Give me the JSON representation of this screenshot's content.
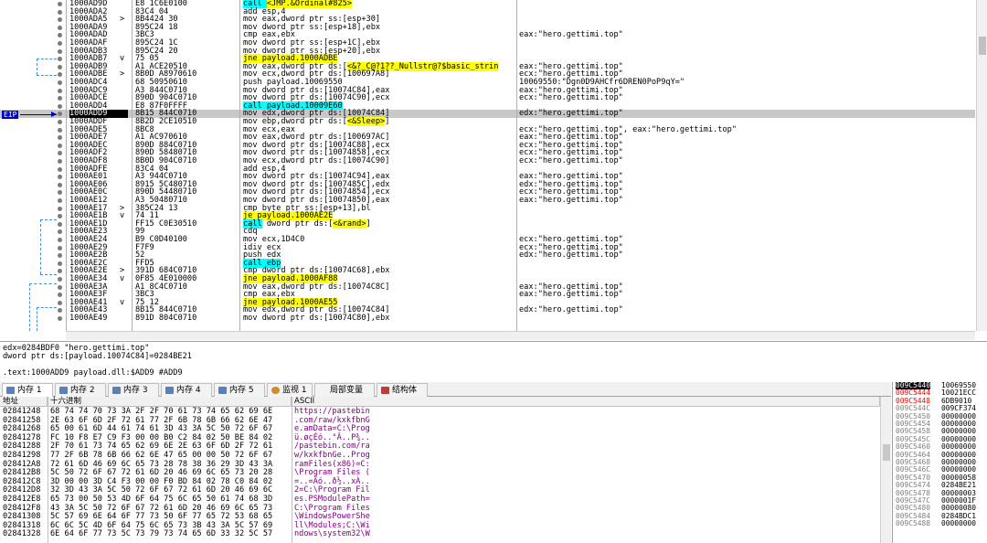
{
  "disasm": {
    "eip_label": "EIP",
    "rows": [
      {
        "addr": "1000AD9D",
        "arrow": "",
        "bytes": "E8 1C6E0100",
        "instr": [
          {
            "t": "call ",
            "c": "call"
          },
          {
            "t": "<JMP.&Ordinal#825>",
            "c": "jmp"
          }
        ],
        "comment": ""
      },
      {
        "addr": "1000ADA2",
        "arrow": "",
        "bytes": "83C4 04",
        "instr": [
          {
            "t": "add esp,4"
          }
        ],
        "comment": ""
      },
      {
        "addr": "1000ADA5",
        "arrow": ">",
        "bytes": "8B4424 30",
        "instr": [
          {
            "t": "mov eax,dword ptr ss:["
          },
          {
            "t": "esp+30",
            "c": "mem"
          },
          {
            "t": "]"
          }
        ],
        "comment": ""
      },
      {
        "addr": "1000ADA9",
        "arrow": "",
        "bytes": "895C24 18",
        "instr": [
          {
            "t": "mov dword ptr ss:["
          },
          {
            "t": "esp+18",
            "c": "mem"
          },
          {
            "t": "],ebx"
          }
        ],
        "comment": ""
      },
      {
        "addr": "1000ADAD",
        "arrow": "",
        "bytes": "3BC3",
        "instr": [
          {
            "t": "cmp eax,ebx"
          }
        ],
        "comment": "eax:\"hero.gettimi.top\""
      },
      {
        "addr": "1000ADAF",
        "arrow": "",
        "bytes": "895C24 1C",
        "instr": [
          {
            "t": "mov dword ptr ss:["
          },
          {
            "t": "esp+1C",
            "c": "mem"
          },
          {
            "t": "],ebx"
          }
        ],
        "comment": ""
      },
      {
        "addr": "1000ADB3",
        "arrow": "",
        "bytes": "895C24 20",
        "instr": [
          {
            "t": "mov dword ptr ss:["
          },
          {
            "t": "esp+20",
            "c": "mem"
          },
          {
            "t": "],ebx"
          }
        ],
        "comment": ""
      },
      {
        "addr": "1000ADB7",
        "arrow": "v",
        "bytes": "75 05",
        "instr": [
          {
            "t": "jne payload.1000ADBE",
            "c": "jmp"
          }
        ],
        "comment": ""
      },
      {
        "addr": "1000ADB9",
        "arrow": "",
        "bytes": "A1 ACE20510",
        "instr": [
          {
            "t": "mov eax,dword ptr ds:["
          },
          {
            "t": "<&?_C@?1??_Nullstr@?$basic_strin",
            "c": "jmp"
          }
        ],
        "comment": "eax:\"hero.gettimi.top\""
      },
      {
        "addr": "1000ADBE",
        "arrow": ">",
        "bytes": "8B0D A8970610",
        "instr": [
          {
            "t": "mov ecx,dword ptr ds:["
          },
          {
            "t": "100697A8",
            "c": "mem"
          },
          {
            "t": "]"
          }
        ],
        "comment": "ecx:\"hero.gettimi.top\""
      },
      {
        "addr": "1000ADC4",
        "arrow": "",
        "bytes": "68 50950610",
        "instr": [
          {
            "t": "push payload.10069550"
          }
        ],
        "comment": "10069550:\"Dgn0D9AHCfr6DREN0PoP9qY=\""
      },
      {
        "addr": "1000ADC9",
        "arrow": "",
        "bytes": "A3 844C0710",
        "instr": [
          {
            "t": "mov dword ptr ds:["
          },
          {
            "t": "10074C84",
            "c": "mem"
          },
          {
            "t": "],eax"
          }
        ],
        "comment": "eax:\"hero.gettimi.top\""
      },
      {
        "addr": "1000ADCE",
        "arrow": "",
        "bytes": "890D 904C0710",
        "instr": [
          {
            "t": "mov dword ptr ds:["
          },
          {
            "t": "10074C90",
            "c": "mem"
          },
          {
            "t": "],ecx"
          }
        ],
        "comment": "ecx:\"hero.gettimi.top\""
      },
      {
        "addr": "1000ADD4",
        "arrow": "",
        "bytes": "E8 87F0FFFF",
        "instr": [
          {
            "t": "call payload.10009E60",
            "c": "call"
          }
        ],
        "comment": ""
      },
      {
        "addr": "1000ADD9",
        "arrow": "",
        "bytes": "8B15 844C0710",
        "instr": [
          {
            "t": "mov edx,dword ptr ds:["
          },
          {
            "t": "10074C84",
            "c": "mem"
          },
          {
            "t": "]"
          }
        ],
        "comment": "edx:\"hero.gettimi.top\"",
        "eip": true
      },
      {
        "addr": "1000ADDF",
        "arrow": "",
        "bytes": "8B2D 2CE10510",
        "instr": [
          {
            "t": "mov ebp,dword ptr ds:["
          },
          {
            "t": "<&Sleep>",
            "c": "jmp"
          },
          {
            "t": "]"
          }
        ],
        "comment": ""
      },
      {
        "addr": "1000ADE5",
        "arrow": "",
        "bytes": "8BC8",
        "instr": [
          {
            "t": "mov ecx,eax"
          }
        ],
        "comment": "ecx:\"hero.gettimi.top\", eax:\"hero.gettimi.top\""
      },
      {
        "addr": "1000ADE7",
        "arrow": "",
        "bytes": "A1 AC970610",
        "instr": [
          {
            "t": "mov eax,dword ptr ds:["
          },
          {
            "t": "100697AC",
            "c": "mem"
          },
          {
            "t": "]"
          }
        ],
        "comment": "eax:\"hero.gettimi.top\""
      },
      {
        "addr": "1000ADEC",
        "arrow": "",
        "bytes": "890D 884C0710",
        "instr": [
          {
            "t": "mov dword ptr ds:["
          },
          {
            "t": "10074C88",
            "c": "mem"
          },
          {
            "t": "],ecx"
          }
        ],
        "comment": "ecx:\"hero.gettimi.top\""
      },
      {
        "addr": "1000ADF2",
        "arrow": "",
        "bytes": "890D 58480710",
        "instr": [
          {
            "t": "mov dword ptr ds:["
          },
          {
            "t": "10074858",
            "c": "mem"
          },
          {
            "t": "],ecx"
          }
        ],
        "comment": "ecx:\"hero.gettimi.top\""
      },
      {
        "addr": "1000ADF8",
        "arrow": "",
        "bytes": "8B0D 904C0710",
        "instr": [
          {
            "t": "mov ecx,dword ptr ds:["
          },
          {
            "t": "10074C90",
            "c": "mem"
          },
          {
            "t": "]"
          }
        ],
        "comment": "ecx:\"hero.gettimi.top\""
      },
      {
        "addr": "1000ADFE",
        "arrow": "",
        "bytes": "83C4 04",
        "instr": [
          {
            "t": "add esp,4"
          }
        ],
        "comment": ""
      },
      {
        "addr": "1000AE01",
        "arrow": "",
        "bytes": "A3 944C0710",
        "instr": [
          {
            "t": "mov dword ptr ds:["
          },
          {
            "t": "10074C94",
            "c": "mem"
          },
          {
            "t": "],eax"
          }
        ],
        "comment": "eax:\"hero.gettimi.top\""
      },
      {
        "addr": "1000AE06",
        "arrow": "",
        "bytes": "8915 5C480710",
        "instr": [
          {
            "t": "mov dword ptr ds:["
          },
          {
            "t": "1007485C",
            "c": "mem"
          },
          {
            "t": "],edx"
          }
        ],
        "comment": "edx:\"hero.gettimi.top\""
      },
      {
        "addr": "1000AE0C",
        "arrow": "",
        "bytes": "890D 54480710",
        "instr": [
          {
            "t": "mov dword ptr ds:["
          },
          {
            "t": "10074854",
            "c": "mem"
          },
          {
            "t": "],ecx"
          }
        ],
        "comment": "ecx:\"hero.gettimi.top\""
      },
      {
        "addr": "1000AE12",
        "arrow": "",
        "bytes": "A3 50480710",
        "instr": [
          {
            "t": "mov dword ptr ds:["
          },
          {
            "t": "10074850",
            "c": "mem"
          },
          {
            "t": "],eax"
          }
        ],
        "comment": "eax:\"hero.gettimi.top\""
      },
      {
        "addr": "1000AE17",
        "arrow": ">",
        "bytes": "385C24 13",
        "instr": [
          {
            "t": "cmp byte ptr ss:["
          },
          {
            "t": "esp+13",
            "c": "mem"
          },
          {
            "t": "],bl"
          }
        ],
        "comment": ""
      },
      {
        "addr": "1000AE1B",
        "arrow": "v",
        "bytes": "74 11",
        "instr": [
          {
            "t": "je payload.1000AE2E",
            "c": "jmp"
          }
        ],
        "comment": ""
      },
      {
        "addr": "1000AE1D",
        "arrow": "",
        "bytes": "FF15 C0E30510",
        "instr": [
          {
            "t": "call",
            "c": "call"
          },
          {
            "t": " dword ptr ds:["
          },
          {
            "t": "<&rand>",
            "c": "jmp"
          },
          {
            "t": "]"
          }
        ],
        "comment": ""
      },
      {
        "addr": "1000AE23",
        "arrow": "",
        "bytes": "99",
        "instr": [
          {
            "t": "cdq"
          }
        ],
        "comment": ""
      },
      {
        "addr": "1000AE24",
        "arrow": "",
        "bytes": "B9 C0D40100",
        "instr": [
          {
            "t": "mov ecx,1D4C0"
          }
        ],
        "comment": "ecx:\"hero.gettimi.top\""
      },
      {
        "addr": "1000AE29",
        "arrow": "",
        "bytes": "F7F9",
        "instr": [
          {
            "t": "idiv ecx"
          }
        ],
        "comment": "ecx:\"hero.gettimi.top\""
      },
      {
        "addr": "1000AE2B",
        "arrow": "",
        "bytes": "52",
        "instr": [
          {
            "t": "push edx"
          }
        ],
        "comment": "edx:\"hero.gettimi.top\""
      },
      {
        "addr": "1000AE2C",
        "arrow": "",
        "bytes": "FFD5",
        "instr": [
          {
            "t": "call ebp",
            "c": "call"
          }
        ],
        "comment": ""
      },
      {
        "addr": "1000AE2E",
        "arrow": ">",
        "bytes": "391D 684C0710",
        "instr": [
          {
            "t": "cmp dword ptr ds:["
          },
          {
            "t": "10074C68",
            "c": "mem"
          },
          {
            "t": "],ebx"
          }
        ],
        "comment": ""
      },
      {
        "addr": "1000AE34",
        "arrow": "v",
        "bytes": "0F85 4E010000",
        "instr": [
          {
            "t": "jne payload.1000AF88",
            "c": "jmp"
          }
        ],
        "comment": ""
      },
      {
        "addr": "1000AE3A",
        "arrow": "",
        "bytes": "A1 8C4C0710",
        "instr": [
          {
            "t": "mov eax,dword ptr ds:["
          },
          {
            "t": "10074C8C",
            "c": "mem"
          },
          {
            "t": "]"
          }
        ],
        "comment": "eax:\"hero.gettimi.top\""
      },
      {
        "addr": "1000AE3F",
        "arrow": "",
        "bytes": "3BC3",
        "instr": [
          {
            "t": "cmp eax,ebx"
          }
        ],
        "comment": "eax:\"hero.gettimi.top\""
      },
      {
        "addr": "1000AE41",
        "arrow": "v",
        "bytes": "75 12",
        "instr": [
          {
            "t": "jne payload.1000AE55",
            "c": "jmp"
          }
        ],
        "comment": ""
      },
      {
        "addr": "1000AE43",
        "arrow": "",
        "bytes": "8B15 844C0710",
        "instr": [
          {
            "t": "mov edx,dword ptr ds:["
          },
          {
            "t": "10074C84",
            "c": "mem"
          },
          {
            "t": "]"
          }
        ],
        "comment": "edx:\"hero.gettimi.top\""
      },
      {
        "addr": "1000AE49",
        "arrow": "",
        "bytes": "891D 804C0710",
        "instr": [
          {
            "t": "mov dword ptr ds:["
          },
          {
            "t": "10074C80",
            "c": "mem"
          },
          {
            "t": "],ebx"
          }
        ],
        "comment": ""
      }
    ]
  },
  "info": {
    "line1": "edx=0284BDF0 \"hero.gettimi.top\"",
    "line2": "dword ptr ds:[payload.10074C84]=0284BE21",
    "line3": ".text:1000ADD9 payload.dll:$ADD9 #ADD9"
  },
  "tabs": [
    {
      "label": "内存 1",
      "active": true,
      "icon": "memory-icon"
    },
    {
      "label": "内存 2",
      "active": false,
      "icon": "memory-icon"
    },
    {
      "label": "内存 3",
      "active": false,
      "icon": "memory-icon"
    },
    {
      "label": "内存 4",
      "active": false,
      "icon": "memory-icon"
    },
    {
      "label": "内存 5",
      "active": false,
      "icon": "memory-icon"
    },
    {
      "label": "监视 1",
      "active": false,
      "icon": "watch-icon"
    },
    {
      "label": "局部变量",
      "active": false,
      "icon": "locals-icon",
      "prefix": "[x=]"
    },
    {
      "label": "结构体",
      "active": false,
      "icon": "struct-icon"
    }
  ],
  "dump": {
    "headers": {
      "addr": "地址",
      "hex": "十六进制",
      "ascii": "ASCII"
    },
    "rows": [
      {
        "addr": "02841248",
        "hex": "68 74 74 70 73 3A 2F 2F 70 61 73 74 65 62 69 6E",
        "ascii": "https://pastebin"
      },
      {
        "addr": "02841258",
        "hex": "2E 63 6F 6D 2F 72 61 77 2F 6B 78 6B 66 62 6E 47",
        "ascii": ".com/raw/kxkfbnG"
      },
      {
        "addr": "02841268",
        "hex": "65 00 61 6D 44 61 74 61 3D 43 3A 5C 50 72 6F 67",
        "ascii": "e.amData=C:\\Prog"
      },
      {
        "addr": "02841278",
        "hex": "FC 10 F8 E7 C9 F3 00 00 B0 C2 84 02 50 BE 84 02",
        "ascii": "ü.øçÉó..°Â..P¾.."
      },
      {
        "addr": "02841288",
        "hex": "2F 70 61 73 74 65 62 69 6E 2E 63 6F 6D 2F 72 61",
        "ascii": "/pastebin.com/ra"
      },
      {
        "addr": "02841298",
        "hex": "77 2F 6B 78 6B 66 62 6E 47 65 00 00 50 72 6F 67",
        "ascii": "w/kxkfbnGe..Prog"
      },
      {
        "addr": "028412A8",
        "hex": "72 61 6D 46 69 6C 65 73 28 78 38 36 29 3D 43 3A",
        "ascii": "ramFiles(x86)=C:"
      },
      {
        "addr": "028412B8",
        "hex": "5C 50 72 6F 67 72 61 6D 20 46 69 6C 65 73 20 28",
        "ascii": "\\Program Files ("
      },
      {
        "addr": "028412C8",
        "hex": "3D 00 00 3D C4 F3 00 00 F0 BD 84 02 78 C0 84 02",
        "ascii": "=..=Äó..ð½..xÀ.."
      },
      {
        "addr": "028412D8",
        "hex": "32 3D 43 3A 5C 50 72 6F 67 72 61 6D 20 46 69 6C",
        "ascii": "2=C:\\Program Fil"
      },
      {
        "addr": "028412E8",
        "hex": "65 73 00 50 53 4D 6F 64 75 6C 65 50 61 74 68 3D",
        "ascii": "es.PSModulePath="
      },
      {
        "addr": "028412F8",
        "hex": "43 3A 5C 50 72 6F 67 72 61 6D 20 46 69 6C 65 73",
        "ascii": "C:\\Program Files"
      },
      {
        "addr": "02841308",
        "hex": "5C 57 69 6E 64 6F 77 73 50 6F 77 65 72 53 68 65",
        "ascii": "\\WindowsPowerShe"
      },
      {
        "addr": "02841318",
        "hex": "6C 6C 5C 4D 6F 64 75 6C 65 73 3B 43 3A 5C 57 69",
        "ascii": "ll\\Modules;C:\\Wi"
      },
      {
        "addr": "02841328",
        "hex": "6E 64 6F 77 73 5C 73 79 73 74 65 6D 33 32 5C 57",
        "ascii": "ndows\\system32\\W"
      }
    ]
  },
  "stack": {
    "rows": [
      {
        "addr": "009C5440",
        "val": "10069550",
        "cur": true
      },
      {
        "addr": "009C5444",
        "val": "10021ECC",
        "red": true
      },
      {
        "addr": "009C5448",
        "val": "6DB9010",
        "red": true
      },
      {
        "addr": "009C544C",
        "val": "009CF374"
      },
      {
        "addr": "009C5450",
        "val": "00000000"
      },
      {
        "addr": "009C5454",
        "val": "00000000"
      },
      {
        "addr": "009C5458",
        "val": "00000000"
      },
      {
        "addr": "009C545C",
        "val": "00000000"
      },
      {
        "addr": "009C5460",
        "val": "00000000"
      },
      {
        "addr": "009C5464",
        "val": "00000000"
      },
      {
        "addr": "009C5468",
        "val": "00000000"
      },
      {
        "addr": "009C546C",
        "val": "00000000"
      },
      {
        "addr": "009C5470",
        "val": "00000058"
      },
      {
        "addr": "009C5474",
        "val": "0284BE21"
      },
      {
        "addr": "009C5478",
        "val": "00000003"
      },
      {
        "addr": "009C547C",
        "val": "0000001F"
      },
      {
        "addr": "009C5480",
        "val": "00000080"
      },
      {
        "addr": "009C5484",
        "val": "0284BDC1"
      },
      {
        "addr": "009C5488",
        "val": "00000000"
      }
    ]
  },
  "colors": {
    "call": "#00ffff",
    "jmp": "#ffff00",
    "eip": "#0000c0",
    "ascii": "#800080",
    "stack_red": "#ff0000"
  }
}
